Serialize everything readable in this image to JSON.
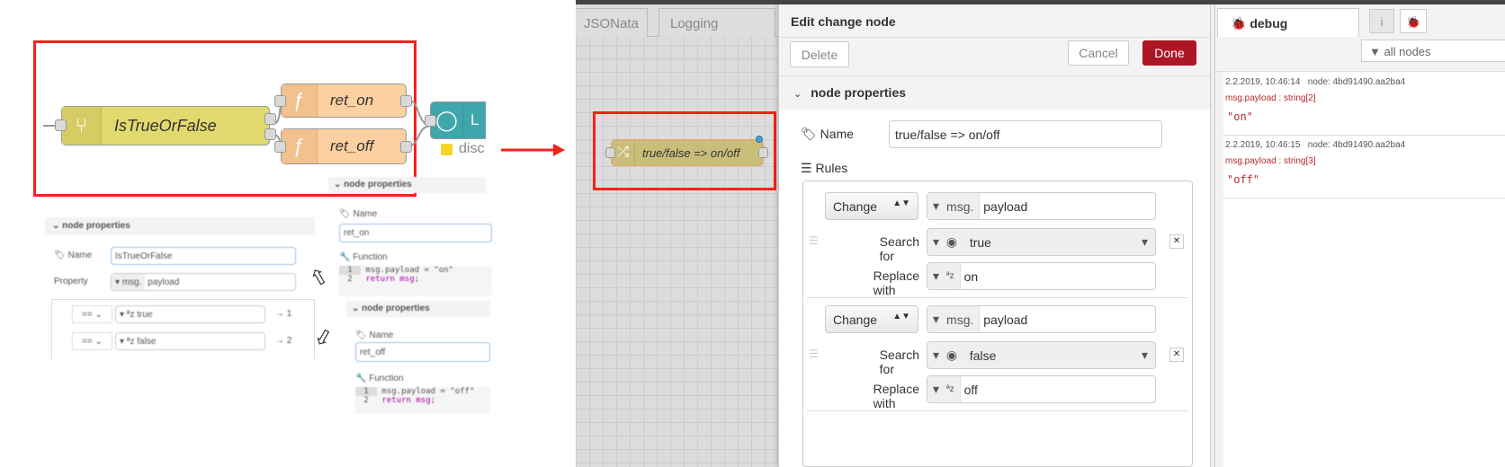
{
  "left": {
    "flow": {
      "switch_node": "IsTrueOrFalse",
      "func1": "ret_on",
      "func2": "ret_off",
      "output_node_label": "L",
      "status_text": "disc"
    },
    "switch_panel": {
      "header": "node properties",
      "name_label": "Name",
      "name_value": "IsTrueOrFalse",
      "property_label": "Property",
      "property_prefix": "msg.",
      "property_value": "payload",
      "rules": [
        {
          "op": "==",
          "value": "true",
          "output": "→ 1"
        },
        {
          "op": "==",
          "value": "false",
          "output": "→ 2"
        }
      ]
    },
    "func_on": {
      "header": "node properties",
      "name_label": "Name",
      "name_value": "ret_on",
      "function_label": "Function",
      "code": [
        {
          "n": "1",
          "line": "msg.payload = \"on\""
        },
        {
          "n": "2",
          "line": "return msg;"
        }
      ]
    },
    "func_off": {
      "header": "node properties",
      "name_label": "Name",
      "name_value": "ret_off",
      "function_label": "Function",
      "code": [
        {
          "n": "1",
          "line": "msg.payload = \"off\""
        },
        {
          "n": "2",
          "line": "return msg;"
        }
      ]
    }
  },
  "workspace": {
    "tabs": [
      "JSONata",
      "Logging"
    ],
    "change_node_label": "true/false => on/off"
  },
  "editor": {
    "title": "Edit change node",
    "delete": "Delete",
    "cancel": "Cancel",
    "done": "Done",
    "section": "node properties",
    "name_label": "Name",
    "name_value": "true/false => on/off",
    "rules_label": "Rules",
    "rules": [
      {
        "action": "Change",
        "target_prefix": "msg.",
        "target": "payload",
        "search_label": "Search for",
        "search_value": "true",
        "replace_label": "Replace with",
        "replace_value": "on"
      },
      {
        "action": "Change",
        "target_prefix": "msg.",
        "target": "payload",
        "search_label": "Search for",
        "search_value": "false",
        "replace_label": "Replace with",
        "replace_value": "off"
      }
    ]
  },
  "debug": {
    "tab": "debug",
    "info_tab": "i",
    "filter": "all nodes",
    "messages": [
      {
        "time": "2.2.2019, 10:46:14",
        "node": "node: 4bd91490.aa2ba4",
        "topic": "msg.payload : string[2]",
        "value": "\"on\""
      },
      {
        "time": "2.2.2019, 10:46:15",
        "node": "node: 4bd91490.aa2ba4",
        "topic": "msg.payload : string[3]",
        "value": "\"off\""
      }
    ]
  },
  "colors": {
    "done": "#ad1625",
    "switch": "#e2d96e",
    "function": "#fdd0a2",
    "change": "#e2d96e",
    "highlight": "#f2231b",
    "debug_text": "#b72828"
  }
}
